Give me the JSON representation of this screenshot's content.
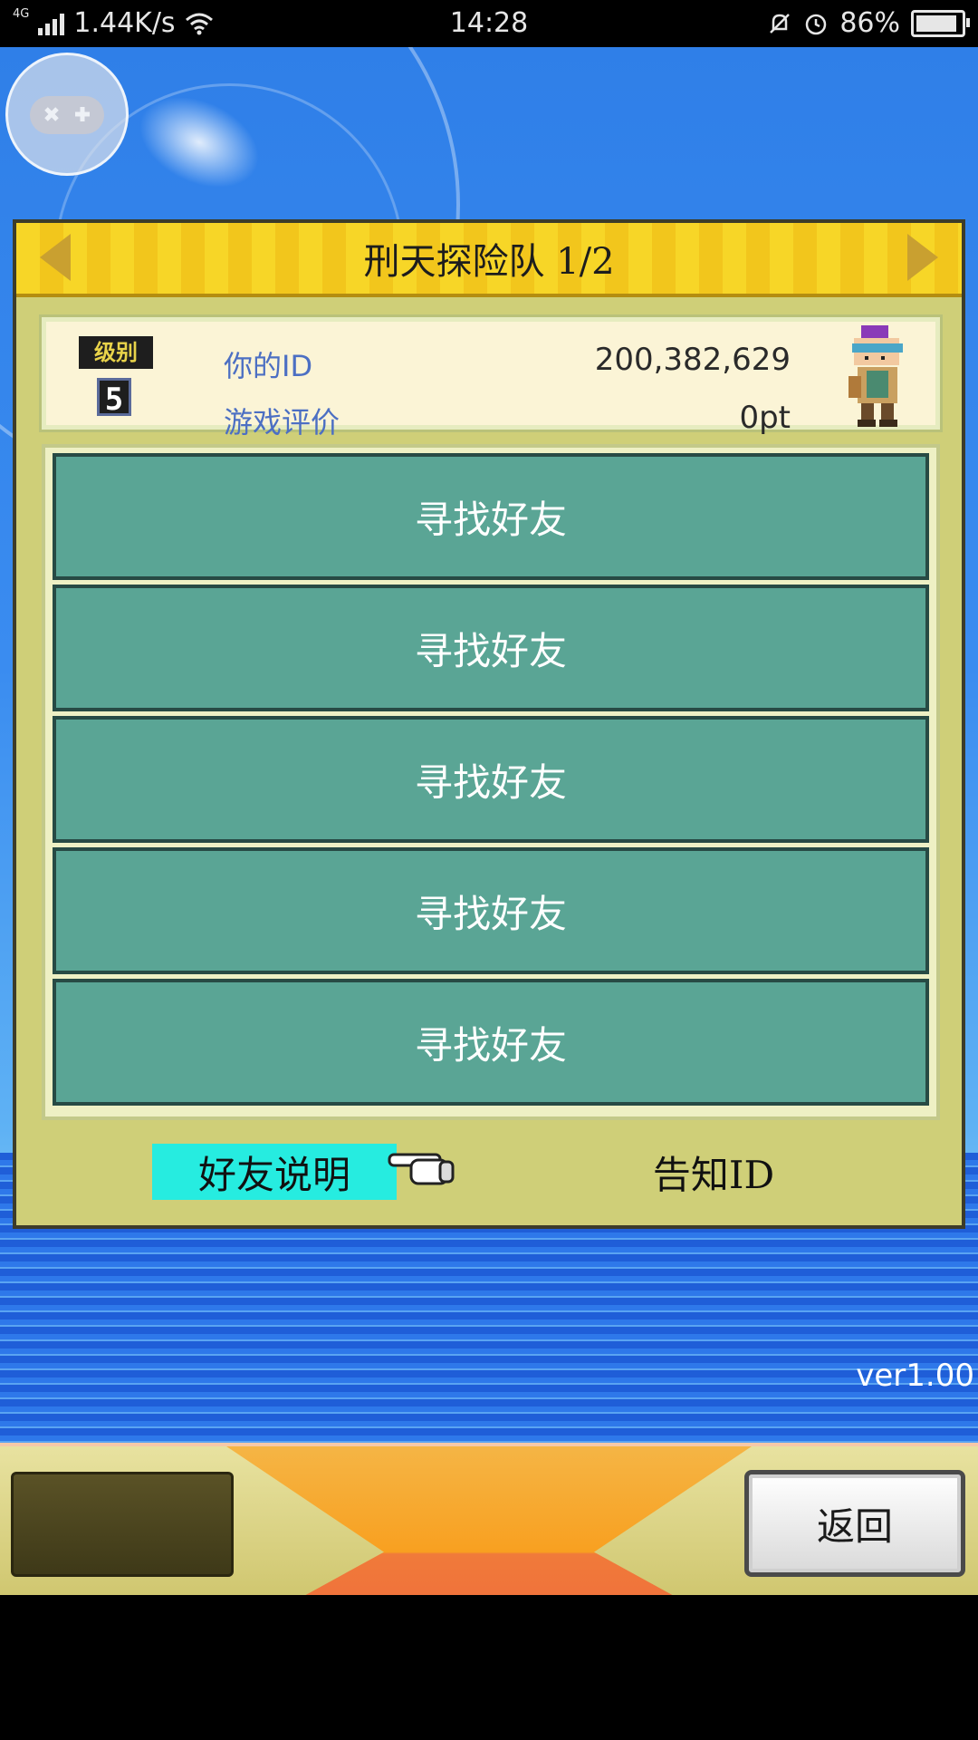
{
  "status_bar": {
    "network_type": "4G",
    "speed": "1.44K/s",
    "time": "14:28",
    "battery": "86%",
    "icons": [
      "signal-icon",
      "wifi-icon",
      "mute-bell-icon",
      "alarm-icon",
      "battery-icon"
    ]
  },
  "game": {
    "gamepad_icon": "gamepad-icon",
    "header": {
      "title": "刑天探险队 1/2"
    },
    "info": {
      "rank_badge": "级别",
      "rank_value": "5",
      "id_label": "你的ID",
      "id_value": "200,382,629",
      "rating_label": "游戏评价",
      "rating_value": "0pt"
    },
    "friend_slots": [
      "寻找好友",
      "寻找好友",
      "寻找好友",
      "寻找好友",
      "寻找好友"
    ],
    "tabs": {
      "explain": "好友说明",
      "notify": "告知ID"
    },
    "version": "ver1.00",
    "bottom": {
      "back": "返回"
    }
  },
  "colors": {
    "panel": "#cfcf78",
    "header": "#f7d627",
    "friend_button": "#5aa595",
    "tab_active": "#26ece0",
    "label_blue": "#4c6fc3"
  }
}
